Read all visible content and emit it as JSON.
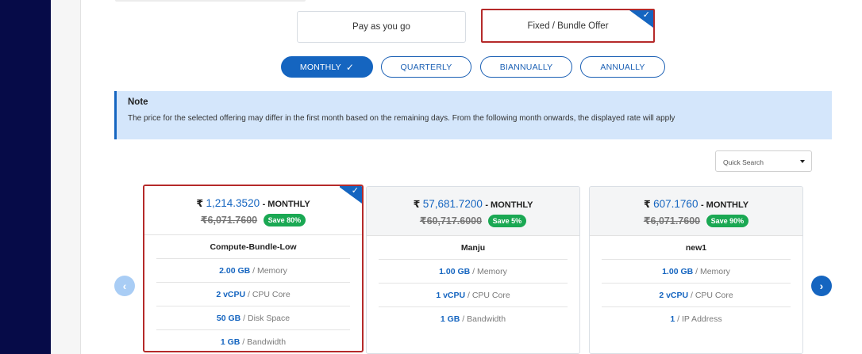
{
  "offers": {
    "pay_as_you_go": "Pay as you go",
    "fixed_bundle": "Fixed / Bundle Offer",
    "selected": "fixed_bundle"
  },
  "periods": [
    {
      "label": "MONTHLY",
      "active": true
    },
    {
      "label": "QUARTERLY",
      "active": false
    },
    {
      "label": "BIANNUALLY",
      "active": false
    },
    {
      "label": "ANNUALLY",
      "active": false
    }
  ],
  "note": {
    "title": "Note",
    "text": "The price for the selected offering may differ in the first month based on the remaining days. From the following month onwards, the displayed rate will apply"
  },
  "quick_search": {
    "placeholder": "Quick Search"
  },
  "currency": "₹",
  "cards": [
    {
      "price": "1,214.3520",
      "period": "- MONTHLY",
      "old_price": "6,071.7600",
      "save": "Save 80%",
      "name": "Compute-Bundle-Low",
      "selected": true,
      "specs": [
        {
          "value": "2.00 GB",
          "label": "/ Memory"
        },
        {
          "value": "2 vCPU",
          "label": "/ CPU Core"
        },
        {
          "value": "50 GB",
          "label": "/ Disk Space"
        },
        {
          "value": "1 GB",
          "label": "/ Bandwidth"
        }
      ]
    },
    {
      "price": "57,681.7200",
      "period": "- MONTHLY",
      "old_price": "60,717.6000",
      "save": "Save 5%",
      "name": "Manju",
      "selected": false,
      "specs": [
        {
          "value": "1.00 GB",
          "label": "/ Memory"
        },
        {
          "value": "1 vCPU",
          "label": "/ CPU Core"
        },
        {
          "value": "1 GB",
          "label": "/ Bandwidth"
        }
      ]
    },
    {
      "price": "607.1760",
      "period": "- MONTHLY",
      "old_price": "6,071.7600",
      "save": "Save 90%",
      "name": "new1",
      "selected": false,
      "specs": [
        {
          "value": "1.00 GB",
          "label": "/ Memory"
        },
        {
          "value": "2 vCPU",
          "label": "/ CPU Core"
        },
        {
          "value": "1",
          "label": "/ IP Address"
        }
      ]
    }
  ],
  "icons": {
    "check": "check-icon",
    "prev": "chevron-left-icon",
    "next": "chevron-right-icon",
    "caret": "caret-down-icon"
  },
  "colors": {
    "accent": "#1565c0",
    "selected_border": "#b52a2a",
    "save_badge": "#1aa853",
    "note_bg": "#d4e6fb",
    "sidebar": "#060b48"
  }
}
